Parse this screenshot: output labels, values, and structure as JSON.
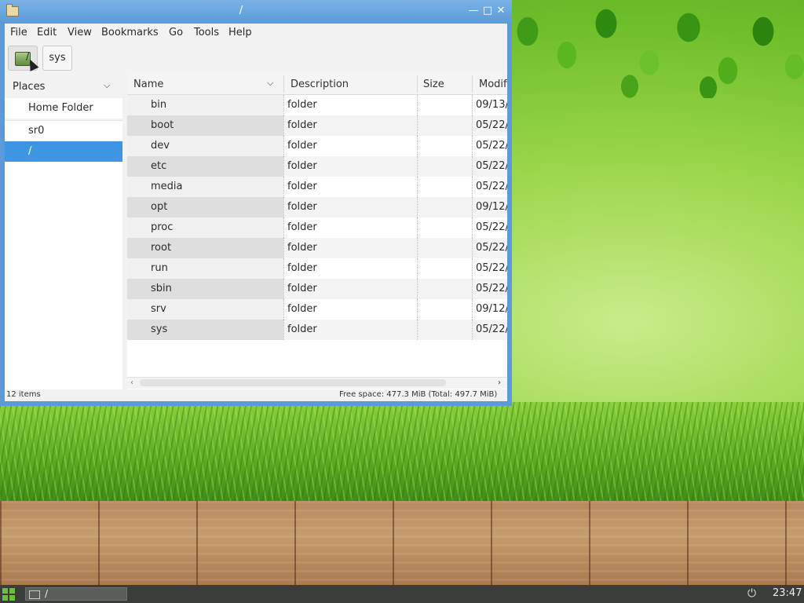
{
  "window": {
    "title": "/",
    "controls": {
      "minimize": "—",
      "maximize": "□",
      "close": "✕"
    }
  },
  "menubar": [
    "File",
    "Edit",
    "View",
    "Bookmarks",
    "Go",
    "Tools",
    "Help"
  ],
  "pathbar": {
    "root_label": "/",
    "sys_label": "sys"
  },
  "sidebar": {
    "header": "Places",
    "items": [
      {
        "label": "Home Folder",
        "selected": false
      },
      {
        "label": "sr0",
        "selected": false
      },
      {
        "label": "/",
        "selected": true
      }
    ]
  },
  "filelist": {
    "columns": [
      "Name",
      "Description",
      "Size",
      "Modifi"
    ],
    "rows": [
      {
        "name": "bin",
        "desc": "folder",
        "size": "",
        "mod": "09/13/"
      },
      {
        "name": "boot",
        "desc": "folder",
        "size": "",
        "mod": "05/22/"
      },
      {
        "name": "dev",
        "desc": "folder",
        "size": "",
        "mod": "05/22/"
      },
      {
        "name": "etc",
        "desc": "folder",
        "size": "",
        "mod": "05/22/"
      },
      {
        "name": "media",
        "desc": "folder",
        "size": "",
        "mod": "05/22/"
      },
      {
        "name": "opt",
        "desc": "folder",
        "size": "",
        "mod": "09/12/"
      },
      {
        "name": "proc",
        "desc": "folder",
        "size": "",
        "mod": "05/22/"
      },
      {
        "name": "root",
        "desc": "folder",
        "size": "",
        "mod": "05/22/"
      },
      {
        "name": "run",
        "desc": "folder",
        "size": "",
        "mod": "05/22/"
      },
      {
        "name": "sbin",
        "desc": "folder",
        "size": "",
        "mod": "05/22/"
      },
      {
        "name": "srv",
        "desc": "folder",
        "size": "",
        "mod": "09/12/"
      },
      {
        "name": "sys",
        "desc": "folder",
        "size": "",
        "mod": "05/22/"
      }
    ]
  },
  "statusbar": {
    "left": "12 items",
    "right": "Free space: 477.3 MiB (Total: 497.7 MiB)"
  },
  "taskbar": {
    "task_label": "/",
    "clock": "23:47"
  },
  "colors": {
    "accent": "#3d95e4",
    "titlebar": "#5b9bd9"
  }
}
